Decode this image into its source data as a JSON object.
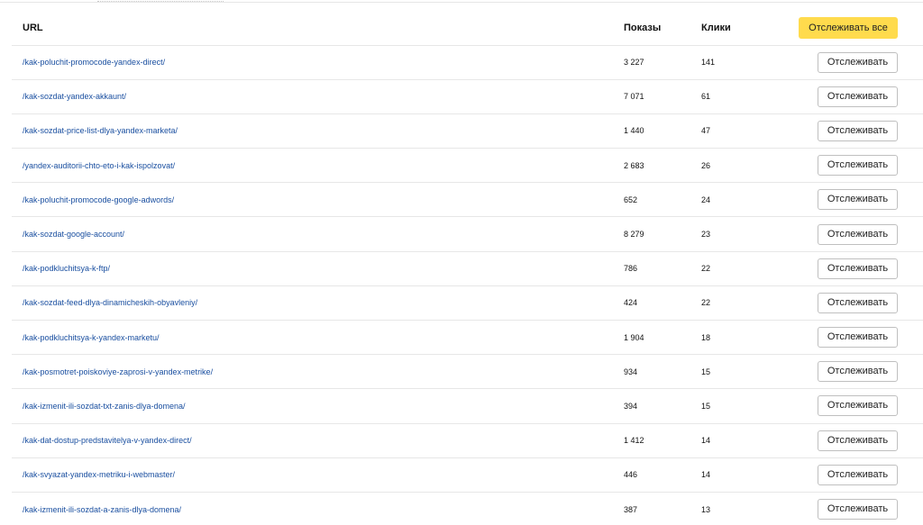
{
  "table": {
    "headers": {
      "url": "URL",
      "shows": "Показы",
      "clicks": "Клики",
      "track_all": "Отслеживать все"
    },
    "track_label": "Отслеживать",
    "rows": [
      {
        "url": "/kak-poluchit-promocode-yandex-direct/",
        "shows": "3 227",
        "clicks": "141"
      },
      {
        "url": "/kak-sozdat-yandex-akkaunt/",
        "shows": "7 071",
        "clicks": "61"
      },
      {
        "url": "/kak-sozdat-price-list-dlya-yandex-marketa/",
        "shows": "1 440",
        "clicks": "47"
      },
      {
        "url": "/yandex-auditorii-chto-eto-i-kak-ispolzovat/",
        "shows": "2 683",
        "clicks": "26"
      },
      {
        "url": "/kak-poluchit-promocode-google-adwords/",
        "shows": "652",
        "clicks": "24"
      },
      {
        "url": "/kak-sozdat-google-account/",
        "shows": "8 279",
        "clicks": "23"
      },
      {
        "url": "/kak-podkluchitsya-k-ftp/",
        "shows": "786",
        "clicks": "22"
      },
      {
        "url": "/kak-sozdat-feed-dlya-dinamicheskih-obyavleniy/",
        "shows": "424",
        "clicks": "22"
      },
      {
        "url": "/kak-podkluchitsya-k-yandex-marketu/",
        "shows": "1 904",
        "clicks": "18"
      },
      {
        "url": "/kak-posmotret-poiskoviye-zaprosi-v-yandex-metrike/",
        "shows": "934",
        "clicks": "15"
      },
      {
        "url": "/kak-izmenit-ili-sozdat-txt-zanis-dlya-domena/",
        "shows": "394",
        "clicks": "15"
      },
      {
        "url": "/kak-dat-dostup-predstavitelya-v-yandex-direct/",
        "shows": "1 412",
        "clicks": "14"
      },
      {
        "url": "/kak-svyazat-yandex-metriku-i-webmaster/",
        "shows": "446",
        "clicks": "14"
      },
      {
        "url": "/kak-izmenit-ili-sozdat-a-zanis-dlya-domena/",
        "shows": "387",
        "clicks": "13"
      }
    ]
  },
  "colors": {
    "accent": "#ffdb4d",
    "link": "#1a4fa0",
    "row_divider": "#e7e7e7"
  }
}
